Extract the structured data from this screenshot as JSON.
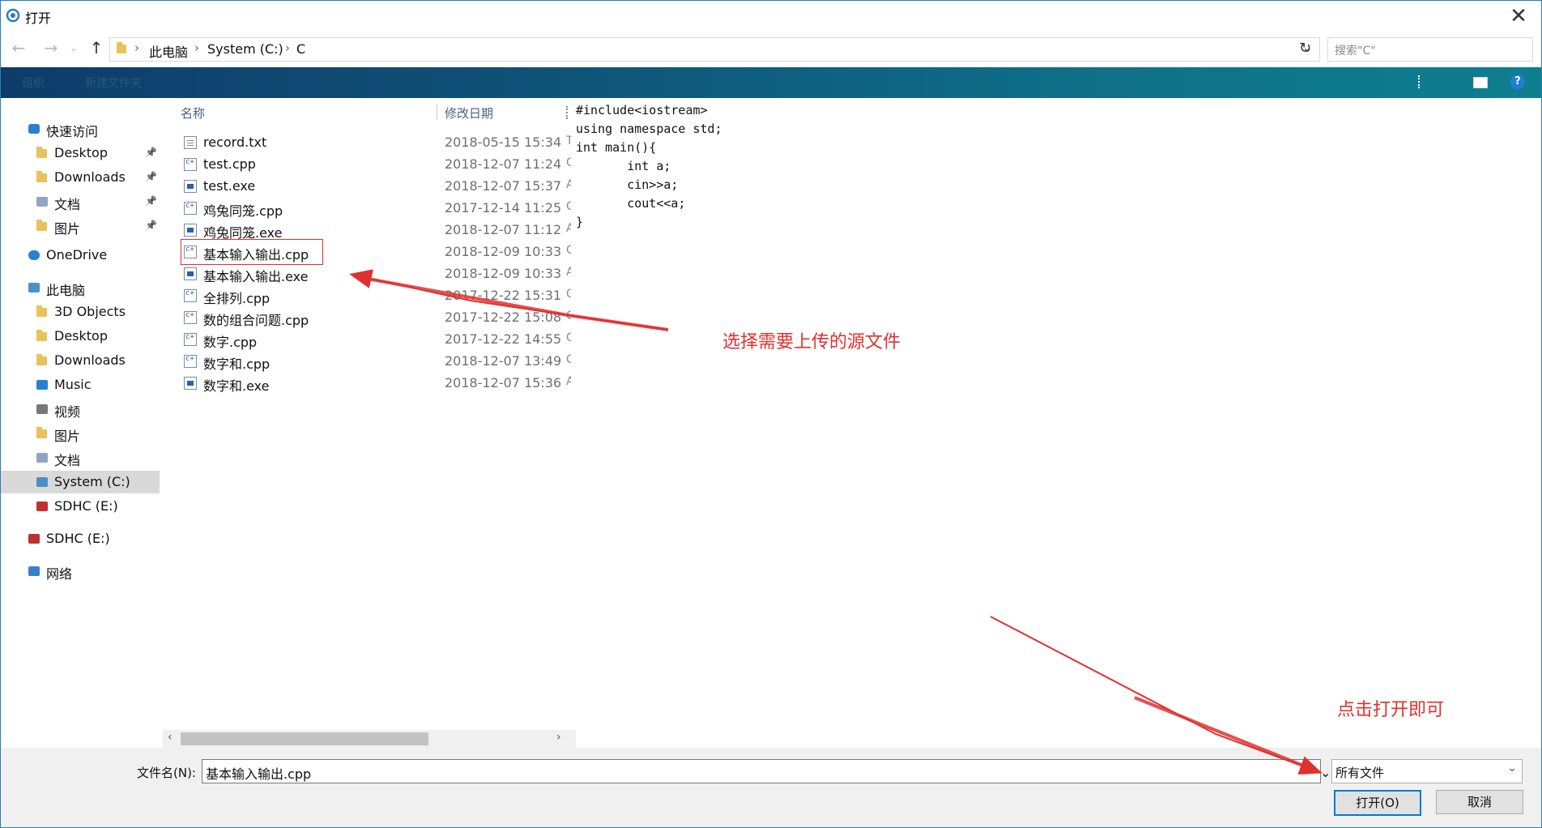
{
  "window": {
    "title": "打开"
  },
  "nav": {
    "breadcrumbs": [
      "此电脑",
      "System (C:)",
      "C"
    ],
    "search_placeholder": "搜索\"C\""
  },
  "ribbon": {
    "items": [
      "组织",
      "新建文件夹"
    ]
  },
  "sidebar": {
    "items": [
      {
        "label": "快速访问",
        "level": 0,
        "icon": "star-icon",
        "pinned": false
      },
      {
        "label": "Desktop",
        "level": 1,
        "icon": "folder-icon",
        "pinned": true
      },
      {
        "label": "Downloads",
        "level": 1,
        "icon": "folder-icon",
        "pinned": true
      },
      {
        "label": "文档",
        "level": 1,
        "icon": "document-icon",
        "pinned": true
      },
      {
        "label": "图片",
        "level": 1,
        "icon": "folder-icon",
        "pinned": true
      },
      {
        "label": "OneDrive",
        "level": 0,
        "icon": "cloud-icon",
        "pinned": false
      },
      {
        "label": "此电脑",
        "level": 0,
        "icon": "computer-icon",
        "pinned": false
      },
      {
        "label": "3D Objects",
        "level": 1,
        "icon": "folder-icon",
        "pinned": false
      },
      {
        "label": "Desktop",
        "level": 1,
        "icon": "folder-icon",
        "pinned": false
      },
      {
        "label": "Downloads",
        "level": 1,
        "icon": "folder-icon",
        "pinned": false
      },
      {
        "label": "Music",
        "level": 1,
        "icon": "music-icon",
        "pinned": false
      },
      {
        "label": "视频",
        "level": 1,
        "icon": "video-icon",
        "pinned": false
      },
      {
        "label": "图片",
        "level": 1,
        "icon": "folder-icon",
        "pinned": false
      },
      {
        "label": "文档",
        "level": 1,
        "icon": "document-icon",
        "pinned": false
      },
      {
        "label": "System (C:)",
        "level": 1,
        "icon": "drive-icon",
        "pinned": false,
        "selected": true
      },
      {
        "label": "SDHC (E:)",
        "level": 1,
        "icon": "sd-card-icon",
        "pinned": false
      },
      {
        "label": "SDHC (E:)",
        "level": 0,
        "icon": "sd-card-icon",
        "pinned": false
      },
      {
        "label": "网络",
        "level": 0,
        "icon": "network-icon",
        "pinned": false
      }
    ]
  },
  "columns": {
    "name": "名称",
    "date": "修改日期"
  },
  "files": [
    {
      "name": "record.txt",
      "date": "2018-05-15 15:34",
      "kind": "txt",
      "type_hint": "T"
    },
    {
      "name": "test.cpp",
      "date": "2018-12-07 11:24",
      "kind": "cpp",
      "type_hint": "C"
    },
    {
      "name": "test.exe",
      "date": "2018-12-07 15:37",
      "kind": "exe",
      "type_hint": "A"
    },
    {
      "name": "鸡兔同笼.cpp",
      "date": "2017-12-14 11:25",
      "kind": "cpp",
      "type_hint": "C"
    },
    {
      "name": "鸡兔同笼.exe",
      "date": "2018-12-07 11:12",
      "kind": "exe",
      "type_hint": "A"
    },
    {
      "name": "基本输入输出.cpp",
      "date": "2018-12-09 10:33",
      "kind": "cpp",
      "type_hint": "C"
    },
    {
      "name": "基本输入输出.exe",
      "date": "2018-12-09 10:33",
      "kind": "exe",
      "type_hint": "A"
    },
    {
      "name": "全排列.cpp",
      "date": "2017-12-22 15:31",
      "kind": "cpp",
      "type_hint": "C"
    },
    {
      "name": "数的组合问题.cpp",
      "date": "2017-12-22 15:08",
      "kind": "cpp",
      "type_hint": "C"
    },
    {
      "name": "数字.cpp",
      "date": "2017-12-22 14:55",
      "kind": "cpp",
      "type_hint": "C"
    },
    {
      "name": "数字和.cpp",
      "date": "2018-12-07 13:49",
      "kind": "cpp",
      "type_hint": "C"
    },
    {
      "name": "数字和.exe",
      "date": "2018-12-07 15:36",
      "kind": "exe",
      "type_hint": "A"
    }
  ],
  "preview": {
    "lines": [
      "#include<iostream>",
      "using namespace std;",
      "int main(){",
      "       int a;",
      "       cin>>a;",
      "       cout<<a;",
      "}"
    ]
  },
  "bottom": {
    "filename_label": "文件名(N):",
    "filename_value": "基本输入输出.cpp",
    "filetype_value": "所有文件",
    "open_label": "打开(O)",
    "cancel_label": "取消"
  },
  "annotations": {
    "select_source": "选择需要上传的源文件",
    "click_open": "点击打开即可",
    "color": "#e03030"
  }
}
